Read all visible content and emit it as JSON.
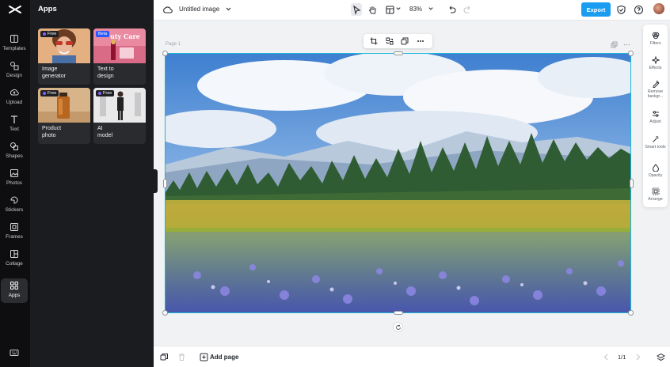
{
  "rail": {
    "items": [
      {
        "label": "Templates",
        "icon": "templates-icon"
      },
      {
        "label": "Design",
        "icon": "design-icon"
      },
      {
        "label": "Upload",
        "icon": "upload-icon"
      },
      {
        "label": "Text",
        "icon": "text-icon"
      },
      {
        "label": "Shapes",
        "icon": "shapes-icon"
      },
      {
        "label": "Photos",
        "icon": "photos-icon"
      },
      {
        "label": "Stickers",
        "icon": "stickers-icon"
      },
      {
        "label": "Frames",
        "icon": "frames-icon"
      },
      {
        "label": "Collage",
        "icon": "collage-icon"
      },
      {
        "label": "Apps",
        "icon": "apps-icon"
      }
    ],
    "active": "Apps"
  },
  "panel": {
    "title": "Apps",
    "cards": [
      {
        "name": "Image generator",
        "line1": "Image",
        "line2": "generator",
        "badge": "Free"
      },
      {
        "name": "Text to design",
        "line1": "Text to",
        "line2": "design",
        "badge": "Beta",
        "thumb_text": "uty Care"
      },
      {
        "name": "Product photo",
        "line1": "Product",
        "line2": "photo",
        "badge": "Free"
      },
      {
        "name": "AI model",
        "line1": "AI",
        "line2": "model",
        "badge": "Free"
      }
    ]
  },
  "topbar": {
    "title": "Untitled image",
    "zoom": "83%",
    "export_label": "Export"
  },
  "canvas": {
    "page_label": "Page 1"
  },
  "right_tools": [
    {
      "label": "Filters",
      "icon": "filters-icon"
    },
    {
      "label": "Effects",
      "icon": "effects-icon"
    },
    {
      "label": "Remove backgr...",
      "icon": "remove-background-icon"
    },
    {
      "label": "Adjust",
      "icon": "adjust-icon"
    },
    {
      "label": "Smart tools",
      "icon": "smart-tools-icon"
    },
    {
      "label": "Opacity",
      "icon": "opacity-icon"
    },
    {
      "label": "Arrange",
      "icon": "arrange-icon"
    }
  ],
  "bottombar": {
    "add_page_label": "Add page",
    "page_counter": "1/1"
  },
  "colors": {
    "accent": "#1a9cf0",
    "selection": "#1fb6d8",
    "rail_bg": "#0e0e10",
    "panel_bg": "#1b1c1f"
  }
}
